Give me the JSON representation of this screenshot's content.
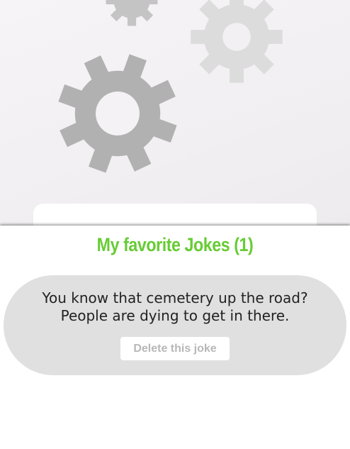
{
  "background": {
    "gears": [
      "gear-icon",
      "gear-icon",
      "gear-icon"
    ],
    "colors": {
      "large_gear": "#b1b1b1",
      "small_gear": "#dcdcdc"
    }
  },
  "favorites": {
    "title": "My favorite Jokes (1)",
    "title_color": "#66cc33",
    "jokes": [
      {
        "text": "You know that cemetery up the road?\nPeople are dying to get in there.",
        "delete_label": "Delete this joke"
      }
    ]
  }
}
